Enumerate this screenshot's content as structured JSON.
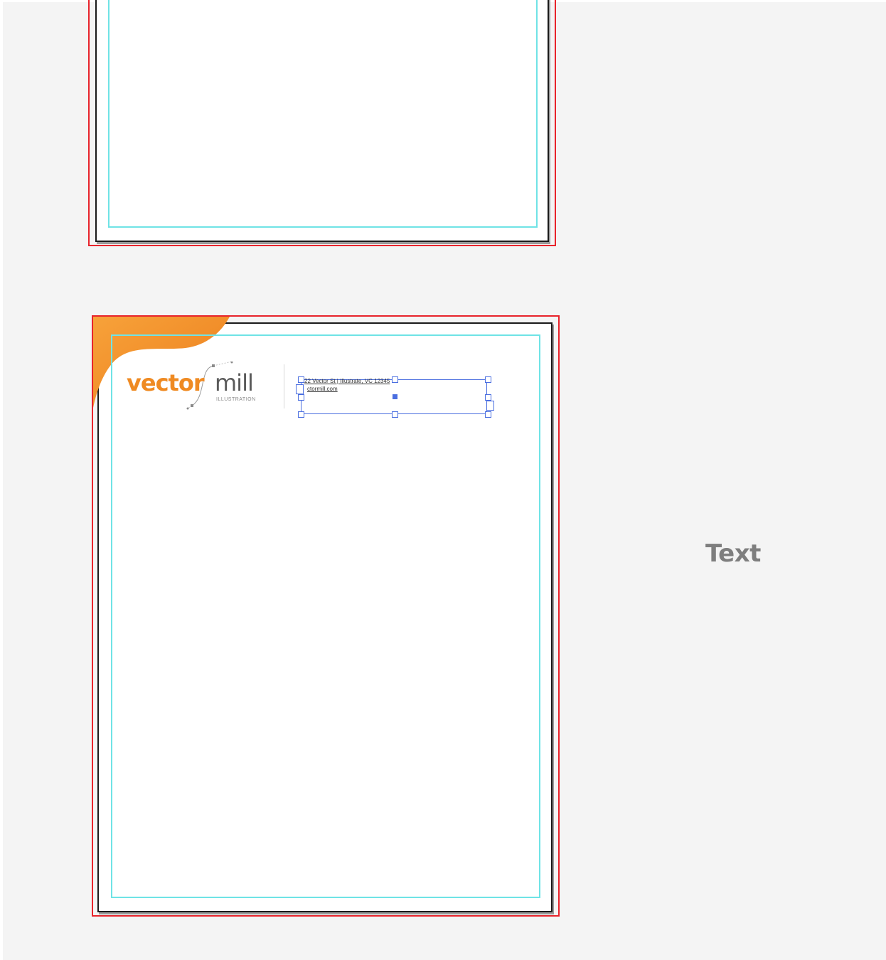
{
  "document": {
    "logo": {
      "word1": "vector",
      "word2": "mill",
      "tagline": "ILLUSTRATION"
    },
    "text_frame": {
      "line1": "22 Vector St | Illustrate, VC 12345",
      "line2": "ctormill.com"
    }
  },
  "overlay_label": "Text",
  "colors": {
    "bleed_guide": "#e8232b",
    "margin_guide": "#6fe3e6",
    "selection": "#4a6ee0",
    "brand_orange": "#ef8a22",
    "pasteboard": "#f4f4f4"
  }
}
